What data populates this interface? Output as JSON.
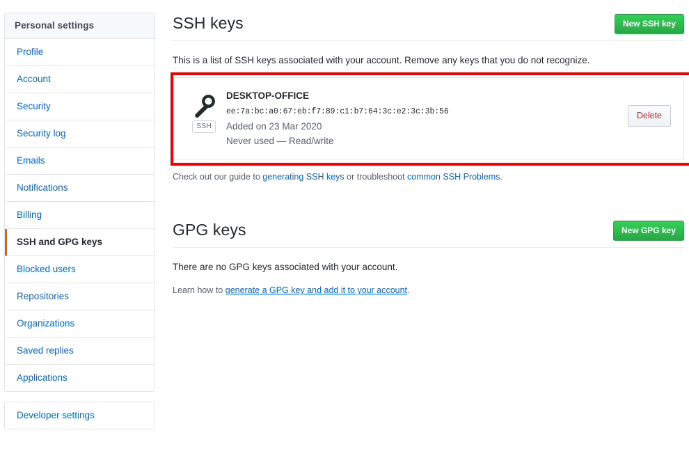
{
  "sidebar": {
    "header": "Personal settings",
    "items": [
      {
        "label": "Profile",
        "selected": false
      },
      {
        "label": "Account",
        "selected": false
      },
      {
        "label": "Security",
        "selected": false
      },
      {
        "label": "Security log",
        "selected": false
      },
      {
        "label": "Emails",
        "selected": false
      },
      {
        "label": "Notifications",
        "selected": false
      },
      {
        "label": "Billing",
        "selected": false
      },
      {
        "label": "SSH and GPG keys",
        "selected": true
      },
      {
        "label": "Blocked users",
        "selected": false
      },
      {
        "label": "Repositories",
        "selected": false
      },
      {
        "label": "Organizations",
        "selected": false
      },
      {
        "label": "Saved replies",
        "selected": false
      },
      {
        "label": "Applications",
        "selected": false
      }
    ],
    "developer_settings": "Developer settings",
    "active_accent_color": "#e36209",
    "link_color": "#0366d6"
  },
  "ssh_section": {
    "title": "SSH keys",
    "new_key_button": "New SSH key",
    "description": "This is a list of SSH keys associated with your account. Remove any keys that you do not recognize.",
    "keys": [
      {
        "title": "DESKTOP-OFFICE",
        "fingerprint": "ee:7a:bc:a0:67:eb:f7:89:c1:b7:64:3c:e2:3c:3b:56",
        "added": "Added on 23 Mar 2020",
        "usage": "Never used — Read/write",
        "badge": "SSH",
        "delete_label": "Delete"
      }
    ],
    "guide": {
      "prefix": "Check out our guide to ",
      "link1": "generating SSH keys",
      "middle": " or troubleshoot ",
      "link2": "common SSH Problems",
      "suffix": "."
    }
  },
  "gpg_section": {
    "title": "GPG keys",
    "new_key_button": "New GPG key",
    "empty_message": "There are no GPG keys associated with your account.",
    "learn": {
      "prefix": "Learn how to ",
      "link": "generate a GPG key and add it to your account",
      "suffix": "."
    }
  },
  "annotation": {
    "highlight_color": "#f50000"
  },
  "colors": {
    "green_button": "#28a745",
    "delete_text": "#cb2431",
    "link": "#0366d6"
  }
}
